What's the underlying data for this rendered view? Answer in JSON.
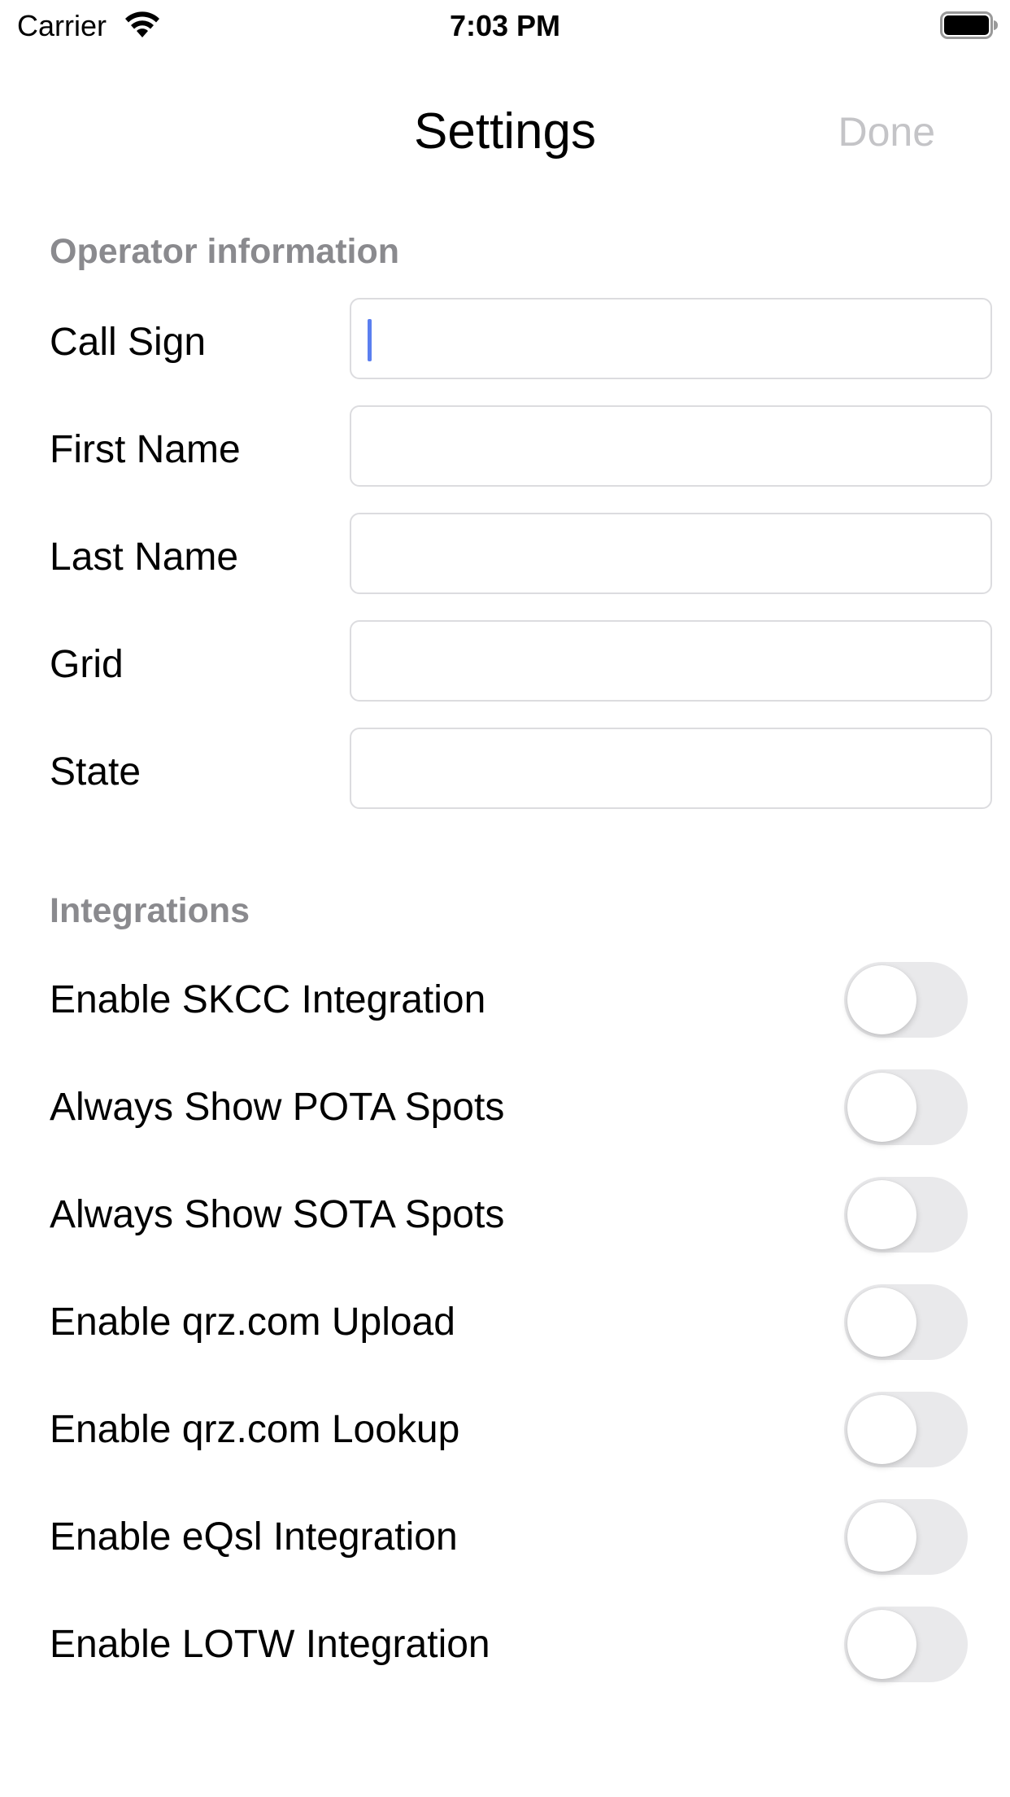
{
  "status_bar": {
    "carrier": "Carrier",
    "time": "7:03 PM",
    "icons": [
      "wifi-icon",
      "battery-icon"
    ]
  },
  "nav": {
    "title": "Settings",
    "done_label": "Done",
    "done_color": "#c4c4c7"
  },
  "operator_section": {
    "header": "Operator information",
    "fields": [
      {
        "label": "Call Sign",
        "value": "",
        "focused": true
      },
      {
        "label": "First Name",
        "value": ""
      },
      {
        "label": "Last Name",
        "value": ""
      },
      {
        "label": "Grid",
        "value": ""
      },
      {
        "label": "State",
        "value": ""
      }
    ]
  },
  "integrations_section": {
    "header": "Integrations",
    "toggles": [
      {
        "label": "Enable SKCC Integration",
        "on": false
      },
      {
        "label": "Always Show POTA Spots",
        "on": false
      },
      {
        "label": "Always Show SOTA Spots",
        "on": false
      },
      {
        "label": "Enable qrz.com Upload",
        "on": false
      },
      {
        "label": "Enable qrz.com Lookup",
        "on": false
      },
      {
        "label": "Enable eQsl Integration",
        "on": false
      },
      {
        "label": "Enable LOTW Integration",
        "on": false
      }
    ]
  },
  "colors": {
    "section_header": "#8a8a8e",
    "toggle_off_track": "#e9e9eb",
    "cursor": "#5b7ff0",
    "input_border": "#dcdcdf"
  }
}
